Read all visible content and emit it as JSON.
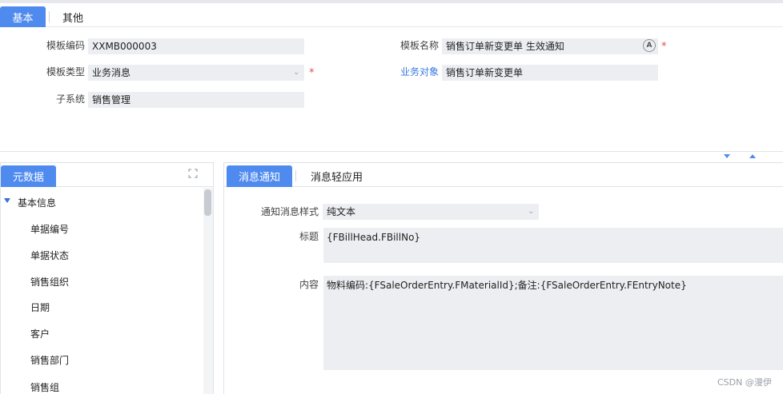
{
  "tabs": [
    {
      "label": "基本",
      "active": true
    },
    {
      "label": "其他",
      "active": false
    }
  ],
  "form": {
    "template_code": {
      "label": "模板编码",
      "value": "XXMB000003"
    },
    "template_name": {
      "label": "模板名称",
      "value": "销售订单新变更单 生效通知",
      "required": "*"
    },
    "template_type": {
      "label": "模板类型",
      "value": "业务消息",
      "required": "*"
    },
    "business_object": {
      "label": "业务对象",
      "value": "销售订单新变更单"
    },
    "subsystem": {
      "label": "子系统",
      "value": "销售管理"
    }
  },
  "metadata_panel": {
    "tab_label": "元数据",
    "root": "基本信息",
    "items": [
      "单据编号",
      "单据状态",
      "销售组织",
      "日期",
      "客户",
      "销售部门",
      "销售组"
    ]
  },
  "notify_panel": {
    "tabs": [
      {
        "label": "消息通知",
        "active": true
      },
      {
        "label": "消息轻应用",
        "active": false
      }
    ],
    "style": {
      "label": "通知消息样式",
      "value": "纯文本"
    },
    "title": {
      "label": "标题",
      "value": "{FBillHead.FBillNo}"
    },
    "content": {
      "label": "内容",
      "value": "物料编码:{FSaleOrderEntry.FMaterialId};备注:{FSaleOrderEntry.FEntryNote}"
    }
  },
  "watermark": "CSDN @漫伊",
  "colors": {
    "accent": "#4f8bef",
    "required": "#e34d4d",
    "link": "#3a7ce0",
    "field_bg": "#eceef2"
  }
}
